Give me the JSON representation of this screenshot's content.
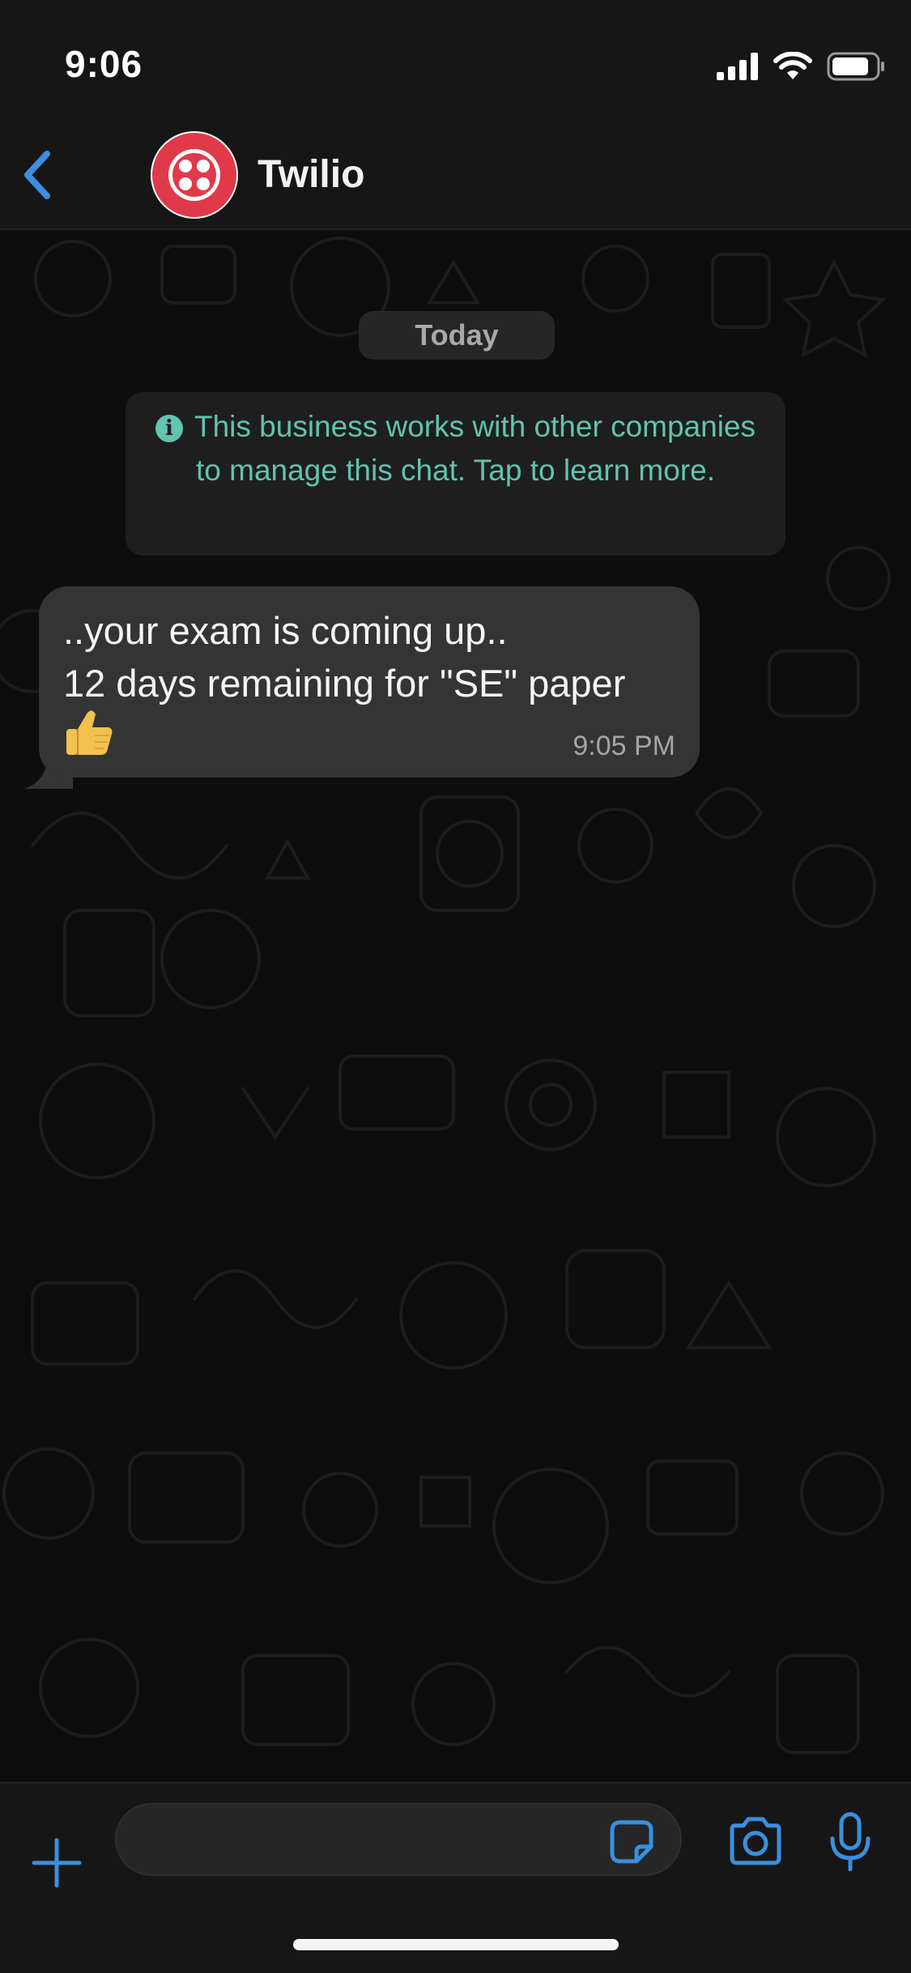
{
  "status_bar": {
    "time": "9:06",
    "icons": [
      "cellular-signal-icon",
      "wifi-icon",
      "battery-icon"
    ]
  },
  "header": {
    "back_icon": "chevron-left-icon",
    "avatar_logo": "twilio-logo",
    "contact_name": "Twilio"
  },
  "chat": {
    "date_label": "Today",
    "info_banner": {
      "icon": "info-icon",
      "text": "This business works with other companies to manage this chat. Tap to learn more."
    },
    "messages": [
      {
        "text": "..your exam is coming up..\n12 days remaining for \"SE\" paper",
        "emoji": "thumbs-up",
        "time": "9:05 PM",
        "direction": "incoming"
      }
    ]
  },
  "input_bar": {
    "value": "",
    "icons": [
      "plus-icon",
      "sticker-icon",
      "camera-icon",
      "microphone-icon"
    ]
  },
  "colors": {
    "accent": "#3a8fe0",
    "banner_text": "#62c3ae",
    "bubble": "#343434",
    "twilio_red": "#e03a4a"
  }
}
